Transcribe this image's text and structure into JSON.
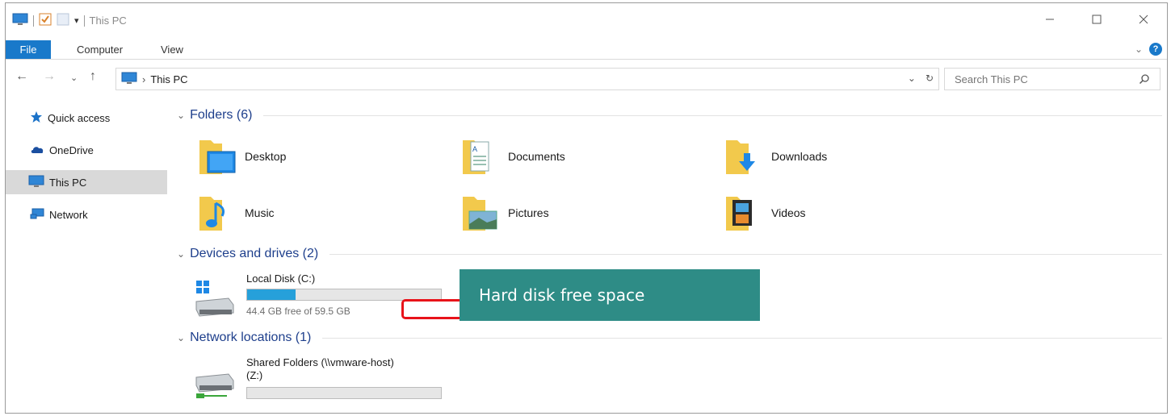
{
  "window": {
    "title": "This PC"
  },
  "ribbon": {
    "tabs": [
      "File",
      "Computer",
      "View"
    ]
  },
  "address": {
    "path": "This PC",
    "search_placeholder": "Search This PC"
  },
  "sidebar": {
    "items": [
      {
        "label": "Quick access",
        "icon": "star-icon"
      },
      {
        "label": "OneDrive",
        "icon": "cloud-icon"
      },
      {
        "label": "This PC",
        "icon": "computer-icon",
        "selected": true
      },
      {
        "label": "Network",
        "icon": "network-icon"
      }
    ]
  },
  "groups": {
    "folders": {
      "label": "Folders (6)"
    },
    "devices": {
      "label": "Devices and drives (2)"
    },
    "network": {
      "label": "Network locations (1)"
    }
  },
  "folders": [
    {
      "name": "Desktop",
      "icon": "desktop-folder-icon"
    },
    {
      "name": "Documents",
      "icon": "documents-folder-icon"
    },
    {
      "name": "Downloads",
      "icon": "downloads-folder-icon"
    },
    {
      "name": "Music",
      "icon": "music-folder-icon"
    },
    {
      "name": "Pictures",
      "icon": "pictures-folder-icon"
    },
    {
      "name": "Videos",
      "icon": "videos-folder-icon"
    }
  ],
  "drives": [
    {
      "name": "Local Disk (C:)",
      "free_text": "44.4 GB free of 59.5 GB",
      "used_fraction": 0.25
    }
  ],
  "network_locations": [
    {
      "name_line1": "Shared Folders (\\\\vmware-host)",
      "name_line2": "(Z:)",
      "used_fraction": 0.0
    }
  ],
  "annotation": {
    "callout": "Hard disk free space"
  },
  "colors": {
    "accent": "#1979ca",
    "callout_bg": "#2e8c86",
    "highlight": "#e8131a",
    "drive_fill": "#26a0da"
  }
}
